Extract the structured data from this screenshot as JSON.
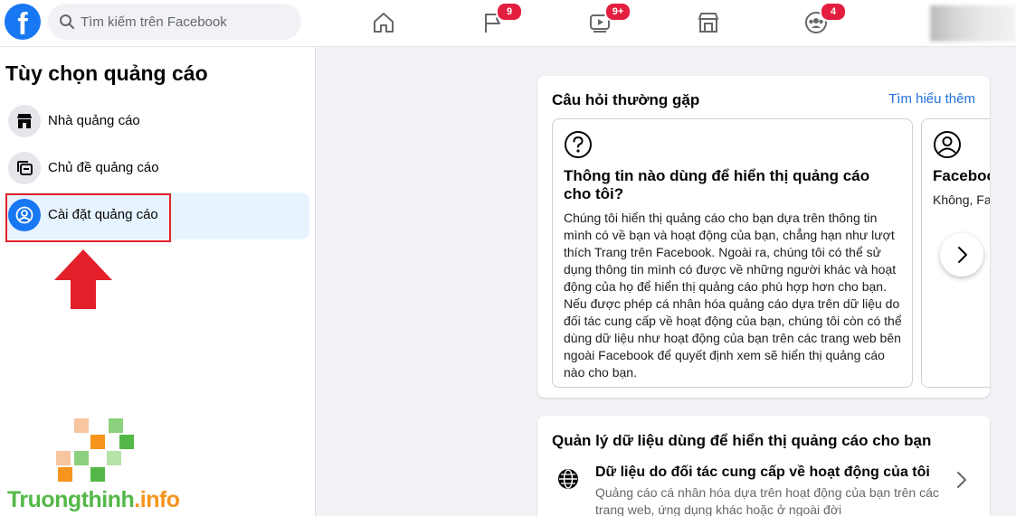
{
  "header": {
    "search_placeholder": "Tìm kiếm trên Facebook",
    "nav": [
      {
        "name": "home",
        "badge": ""
      },
      {
        "name": "pages",
        "badge": "9"
      },
      {
        "name": "watch",
        "badge": "9+"
      },
      {
        "name": "marketplace",
        "badge": ""
      },
      {
        "name": "groups",
        "badge": "4"
      }
    ]
  },
  "sidebar": {
    "title": "Tùy chọn quảng cáo",
    "items": [
      {
        "label": "Nhà quảng cáo",
        "icon": "store-icon"
      },
      {
        "label": "Chủ đề quảng cáo",
        "icon": "topics-icon"
      },
      {
        "label": "Cài đặt quảng cáo",
        "icon": "user-circle-icon",
        "active": true
      }
    ]
  },
  "watermark": {
    "text_green": "Truongthinh",
    "text_orange": ".info"
  },
  "faq_card": {
    "title": "Câu hỏi thường gặp",
    "link": "Tìm hiểu thêm",
    "items": [
      {
        "title": "Thông tin nào dùng để hiển thị quảng cáo cho tôi?",
        "body": "Chúng tôi hiển thị quảng cáo cho bạn dựa trên thông tin mình có về bạn và hoạt động của bạn, chẳng hạn như lượt thích Trang trên Facebook. Ngoài ra, chúng tôi có thể sử dụng thông tin mình có được về những người khác và hoạt động của họ để hiển thị quảng cáo phù hợp hơn cho bạn. Nếu được phép cá nhân hóa quảng cáo dựa trên dữ liệu do đối tác cung cấp về hoạt động của bạn, chúng tôi còn có thể dùng dữ liệu như hoạt động của bạn trên các trang web bên ngoài Facebook để quyết định xem sẽ hiển thị quảng cáo nào cho bạn."
      },
      {
        "title": "Faceboo",
        "body": "Không, Fa cá nhân n Facebook"
      }
    ]
  },
  "data_card": {
    "title": "Quản lý dữ liệu dùng để hiển thị quảng cáo cho bạn",
    "row_title": "Dữ liệu do đối tác cung cấp về hoạt động của tôi",
    "row_desc": "Quảng cáo cá nhân hóa dựa trên hoạt động của bạn trên các trang web, ứng dụng khác hoặc ở ngoài đời"
  }
}
